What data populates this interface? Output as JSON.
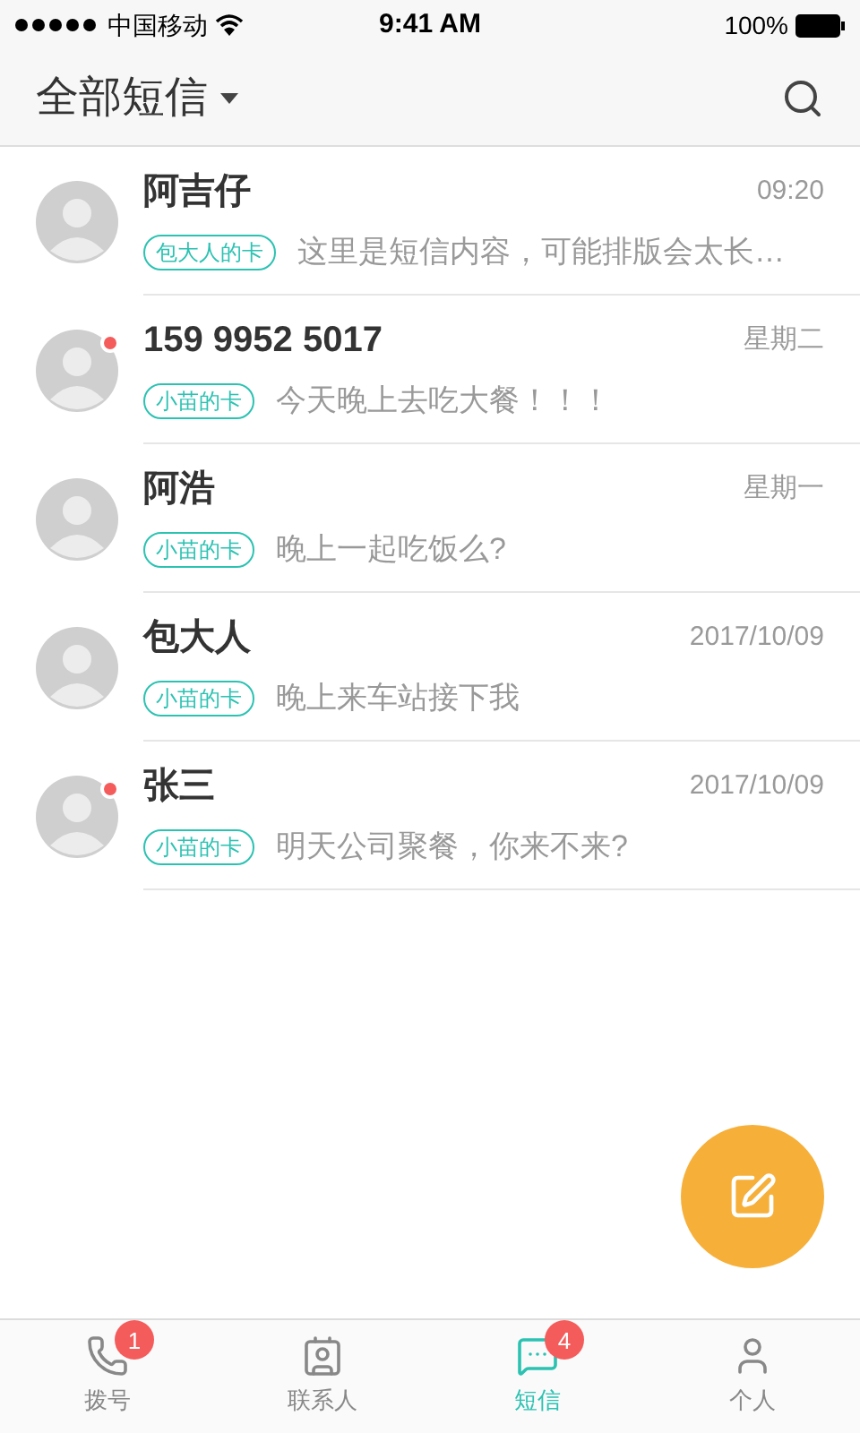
{
  "status_bar": {
    "carrier": "中国移动",
    "time": "9:41 AM",
    "battery": "100%"
  },
  "header": {
    "title": "全部短信"
  },
  "messages": [
    {
      "name": "阿吉仔",
      "time": "09:20",
      "card": "包大人的卡",
      "preview": "这里是短信内容，可能排版会太长…",
      "unread": false
    },
    {
      "name": "159 9952 5017",
      "time": "星期二",
      "card": "小苗的卡",
      "preview": "今天晚上去吃大餐！！！",
      "unread": true
    },
    {
      "name": "阿浩",
      "time": "星期一",
      "card": "小苗的卡",
      "preview": "晚上一起吃饭么?",
      "unread": false
    },
    {
      "name": "包大人",
      "time": "2017/10/09",
      "card": "小苗的卡",
      "preview": "晚上来车站接下我",
      "unread": false
    },
    {
      "name": "张三",
      "time": "2017/10/09",
      "card": "小苗的卡",
      "preview": "明天公司聚餐，你来不来?",
      "unread": true
    }
  ],
  "tabs": [
    {
      "kind": "phone",
      "label": "拨号",
      "badge": "1",
      "selected": false
    },
    {
      "kind": "contacts",
      "label": "联系人",
      "selected": false
    },
    {
      "kind": "sms",
      "label": "短信",
      "badge": "4",
      "selected": true
    },
    {
      "kind": "person",
      "label": "个人",
      "selected": false
    }
  ]
}
